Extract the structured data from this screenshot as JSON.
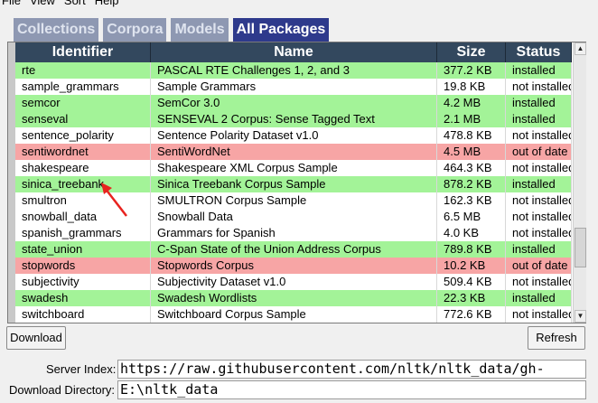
{
  "menu": [
    "File",
    "View",
    "Sort",
    "Help"
  ],
  "tabs": [
    "Collections",
    "Corpora",
    "Models",
    "All Packages"
  ],
  "active_tab": "All Packages",
  "columns": {
    "identifier": "Identifier",
    "name": "Name",
    "size": "Size",
    "status": "Status"
  },
  "rows": [
    {
      "id": "rte",
      "name": "PASCAL RTE Challenges 1, 2, and 3",
      "size": "377.2 KB",
      "status": "installed"
    },
    {
      "id": "sample_grammars",
      "name": "Sample Grammars",
      "size": "19.8 KB",
      "status": "not installed"
    },
    {
      "id": "semcor",
      "name": "SemCor 3.0",
      "size": "4.2 MB",
      "status": "installed"
    },
    {
      "id": "senseval",
      "name": "SENSEVAL 2 Corpus: Sense Tagged Text",
      "size": "2.1 MB",
      "status": "installed"
    },
    {
      "id": "sentence_polarity",
      "name": "Sentence Polarity Dataset v1.0",
      "size": "478.8 KB",
      "status": "not installed"
    },
    {
      "id": "sentiwordnet",
      "name": "SentiWordNet",
      "size": "4.5 MB",
      "status": "out of date"
    },
    {
      "id": "shakespeare",
      "name": "Shakespeare XML Corpus Sample",
      "size": "464.3 KB",
      "status": "not installed"
    },
    {
      "id": "sinica_treebank",
      "name": "Sinica Treebank Corpus Sample",
      "size": "878.2 KB",
      "status": "installed"
    },
    {
      "id": "smultron",
      "name": "SMULTRON Corpus Sample",
      "size": "162.3 KB",
      "status": "not installed"
    },
    {
      "id": "snowball_data",
      "name": "Snowball Data",
      "size": "6.5 MB",
      "status": "not installed"
    },
    {
      "id": "spanish_grammars",
      "name": "Grammars for Spanish",
      "size": "4.0 KB",
      "status": "not installed"
    },
    {
      "id": "state_union",
      "name": "C-Span State of the Union Address Corpus",
      "size": "789.8 KB",
      "status": "installed"
    },
    {
      "id": "stopwords",
      "name": "Stopwords Corpus",
      "size": "10.2 KB",
      "status": "out of date"
    },
    {
      "id": "subjectivity",
      "name": "Subjectivity Dataset v1.0",
      "size": "509.4 KB",
      "status": "not installed"
    },
    {
      "id": "swadesh",
      "name": "Swadesh Wordlists",
      "size": "22.3 KB",
      "status": "installed"
    },
    {
      "id": "switchboard",
      "name": "Switchboard Corpus Sample",
      "size": "772.6 KB",
      "status": "not installed"
    }
  ],
  "buttons": {
    "download": "Download",
    "refresh": "Refresh"
  },
  "fields": {
    "server_label": "Server Index:",
    "server_value": "https://raw.githubusercontent.com/nltk/nltk_data/gh-",
    "dir_label": "Download Directory:",
    "dir_value": "E:\\nltk_data"
  },
  "colors": {
    "installed": "#a3f398",
    "not_installed": "#ffffff",
    "out_of_date": "#f7a5a5",
    "header": "#33485e",
    "tab_active": "#2e3a8c",
    "tab": "#8e98b2",
    "annotation": "#e8231f"
  }
}
